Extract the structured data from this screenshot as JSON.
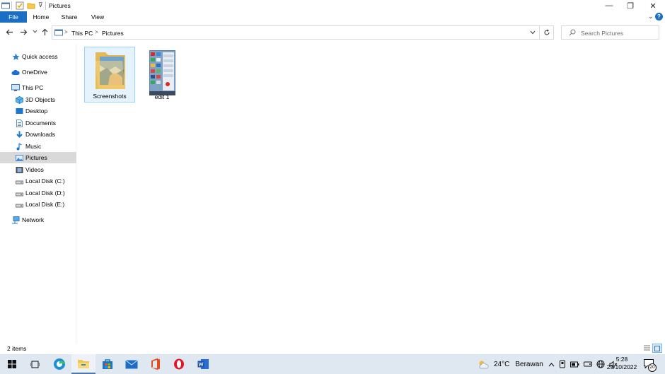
{
  "window": {
    "title": "Pictures",
    "minimize_glyph": "—",
    "maximize_glyph": "❐",
    "close_glyph": "✕"
  },
  "ribbon": {
    "tabs": [
      {
        "label": "File"
      },
      {
        "label": "Home"
      },
      {
        "label": "Share"
      },
      {
        "label": "View"
      }
    ],
    "help_glyph": "?"
  },
  "address": {
    "breadcrumbs": [
      {
        "label": "This PC"
      },
      {
        "label": "Pictures"
      }
    ],
    "separator": ">"
  },
  "search": {
    "placeholder": "Search Pictures"
  },
  "sidebar": {
    "items": [
      {
        "label": "Quick access",
        "icon": "star-icon"
      },
      {
        "label": "OneDrive",
        "icon": "cloud-icon"
      },
      {
        "label": "This PC",
        "icon": "computer-icon"
      },
      {
        "label": "3D Objects",
        "icon": "cube-icon"
      },
      {
        "label": "Desktop",
        "icon": "desktop-icon"
      },
      {
        "label": "Documents",
        "icon": "document-icon"
      },
      {
        "label": "Downloads",
        "icon": "download-icon"
      },
      {
        "label": "Music",
        "icon": "music-icon"
      },
      {
        "label": "Pictures",
        "icon": "pictures-icon",
        "selected": true
      },
      {
        "label": "Videos",
        "icon": "video-icon"
      },
      {
        "label": "Local Disk (C:)",
        "icon": "disk-icon"
      },
      {
        "label": "Local Disk (D:)",
        "icon": "disk-icon"
      },
      {
        "label": "Local Disk (E:)",
        "icon": "disk-icon"
      },
      {
        "label": "Network",
        "icon": "network-icon"
      }
    ]
  },
  "files": [
    {
      "name": "Screenshots",
      "type": "folder",
      "selected": true
    },
    {
      "name": "edit 1",
      "type": "image"
    }
  ],
  "status": {
    "item_count": "2 items"
  },
  "taskbar": {
    "weather_temp": "24°C",
    "weather_desc": "Berawan",
    "time": "5:28",
    "date": "29/10/2022",
    "notification_count": "20"
  },
  "colors": {
    "accent": "#1a6fc4",
    "selection_bg": "#e5f3ff",
    "selection_border": "#99d1ff",
    "sidebar_selected": "#d9d9d9",
    "taskbar_bg": "#dfe7f1"
  }
}
